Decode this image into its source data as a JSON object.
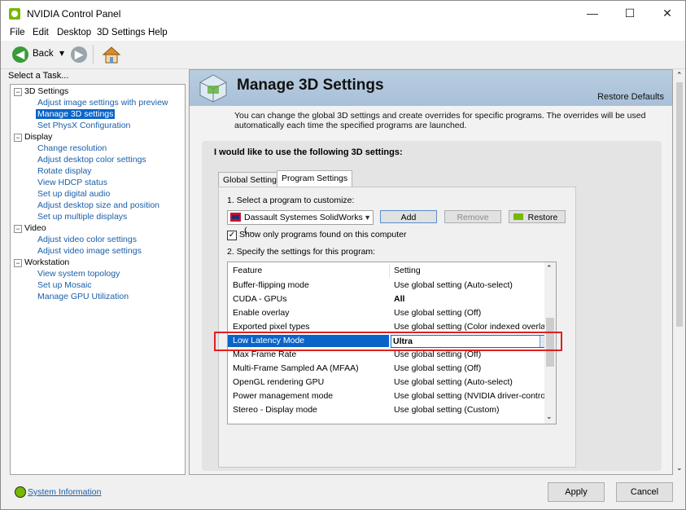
{
  "window": {
    "title": "NVIDIA Control Panel",
    "minimize": "—",
    "maximize": "☐",
    "close": "✕"
  },
  "menu": [
    "File",
    "Edit",
    "Desktop",
    "3D Settings",
    "Help"
  ],
  "toolbar": {
    "back_label": "Back",
    "back_icon": "◀",
    "forward_icon": "▶",
    "dropdown_icon": "▾"
  },
  "left_panel": {
    "heading": "Select a Task...",
    "tree": [
      {
        "label": "3D Settings",
        "type": "category"
      },
      {
        "label": "Adjust image settings with preview",
        "type": "link"
      },
      {
        "label": "Manage 3D settings",
        "type": "link",
        "selected": true
      },
      {
        "label": "Set PhysX Configuration",
        "type": "link"
      },
      {
        "label": "Display",
        "type": "category"
      },
      {
        "label": "Change resolution",
        "type": "link"
      },
      {
        "label": "Adjust desktop color settings",
        "type": "link"
      },
      {
        "label": "Rotate display",
        "type": "link"
      },
      {
        "label": "View HDCP status",
        "type": "link"
      },
      {
        "label": "Set up digital audio",
        "type": "link"
      },
      {
        "label": "Adjust desktop size and position",
        "type": "link"
      },
      {
        "label": "Set up multiple displays",
        "type": "link"
      },
      {
        "label": "Video",
        "type": "category"
      },
      {
        "label": "Adjust video color settings",
        "type": "link"
      },
      {
        "label": "Adjust video image settings",
        "type": "link"
      },
      {
        "label": "Workstation",
        "type": "category"
      },
      {
        "label": "View system topology",
        "type": "link"
      },
      {
        "label": "Set up Mosaic",
        "type": "link"
      },
      {
        "label": "Manage GPU Utilization",
        "type": "link"
      }
    ]
  },
  "main": {
    "title": "Manage 3D Settings",
    "restore_defaults": "Restore Defaults",
    "description": "You can change the global 3D settings and create overrides for specific programs. The overrides will be used automatically each time the specified programs are launched.",
    "box_heading": "I would like to use the following 3D settings:",
    "tabs": [
      "Global Settings",
      "Program Settings"
    ],
    "active_tab": "Program Settings",
    "select_label": "1. Select a program to customize:",
    "program_value": "Dassault Systemes SolidWorks (...",
    "add_label": "Add",
    "remove_label": "Remove",
    "restore_label": "Restore",
    "show_only_label": "Show only programs found on this computer",
    "show_only_checked": true,
    "specify_label": "2. Specify the settings for this program:",
    "grid_headers": {
      "feature": "Feature",
      "setting": "Setting"
    },
    "grid_rows": [
      {
        "feature": "Buffer-flipping mode",
        "setting": "Use global setting (Auto-select)"
      },
      {
        "feature": "CUDA - GPUs",
        "setting": "All"
      },
      {
        "feature": "Enable overlay",
        "setting": "Use global setting (Off)"
      },
      {
        "feature": "Exported pixel types",
        "setting": "Use global setting (Color indexed overlays..."
      },
      {
        "feature": "Low Latency Mode",
        "setting": "Ultra",
        "selected": true
      },
      {
        "feature": "Max Frame Rate",
        "setting": "Use global setting (Off)"
      },
      {
        "feature": "Multi-Frame Sampled AA (MFAA)",
        "setting": "Use global setting (Off)"
      },
      {
        "feature": "OpenGL rendering GPU",
        "setting": "Use global setting (Auto-select)"
      },
      {
        "feature": "Power management mode",
        "setting": "Use global setting (NVIDIA driver-controlled)"
      },
      {
        "feature": "Stereo - Display mode",
        "setting": "Use global setting (Custom)"
      }
    ]
  },
  "status_bar": {
    "system_info": "System Information",
    "apply": "Apply",
    "cancel": "Cancel"
  },
  "colors": {
    "selection": "#0a64c8",
    "link": "#1a5ea8",
    "highlight_border": "#e02020",
    "nvidia_green": "#76b900"
  }
}
